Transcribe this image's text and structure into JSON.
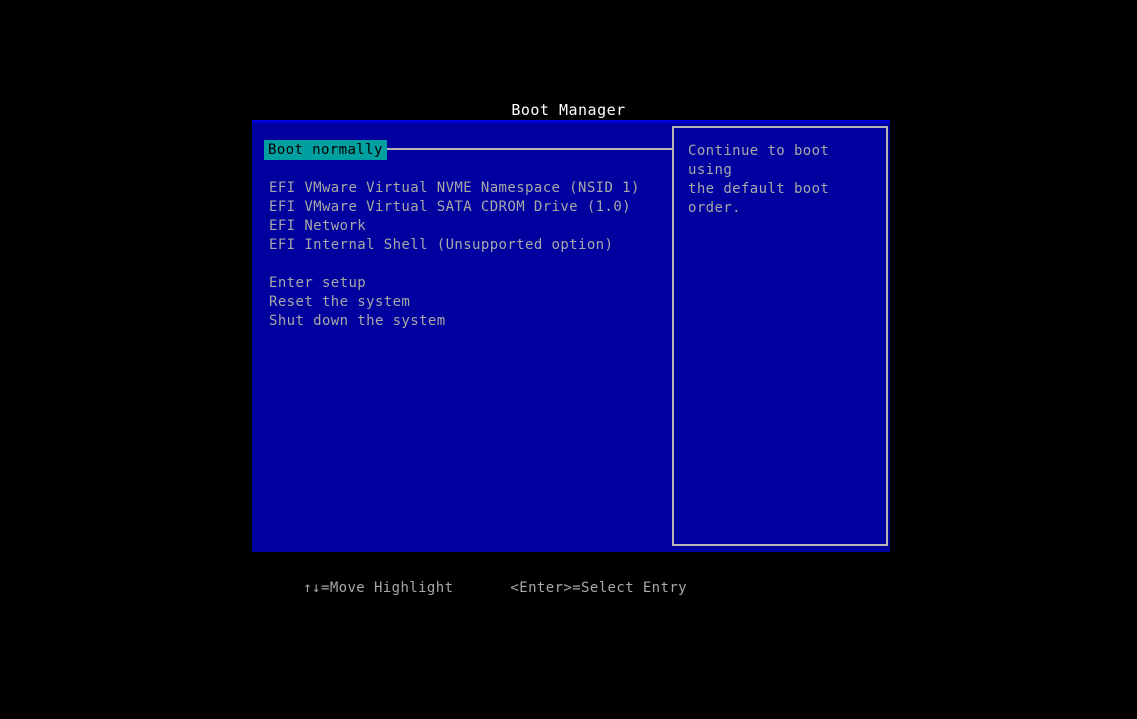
{
  "screen": {
    "title": "Boot Manager",
    "background_color": "#000000",
    "panel_color": "#00009e",
    "panel_top_border_color": "#0000d8",
    "text_color": "#a8a8a8",
    "title_color": "#ffffff",
    "highlight_bg_color": "#00a0a0",
    "highlight_text_color": "#000000",
    "border_color": "#b4b4b4"
  },
  "menu": {
    "items": [
      {
        "label": "Boot normally",
        "selected": true
      },
      {
        "label": "",
        "spacer": true
      },
      {
        "label": "EFI VMware Virtual NVME Namespace (NSID 1)",
        "selected": false
      },
      {
        "label": "EFI VMware Virtual SATA CDROM Drive (1.0)",
        "selected": false
      },
      {
        "label": "EFI Network",
        "selected": false
      },
      {
        "label": "EFI Internal Shell (Unsupported option)",
        "selected": false
      },
      {
        "label": "",
        "spacer": true
      },
      {
        "label": "Enter setup",
        "selected": false
      },
      {
        "label": "Reset the system",
        "selected": false
      },
      {
        "label": "Shut down the system",
        "selected": false
      }
    ]
  },
  "help": {
    "text": "Continue to boot using\nthe default boot order."
  },
  "footer": {
    "move_hint": "↑↓=Move Highlight",
    "select_hint": "<Enter>=Select Entry"
  }
}
